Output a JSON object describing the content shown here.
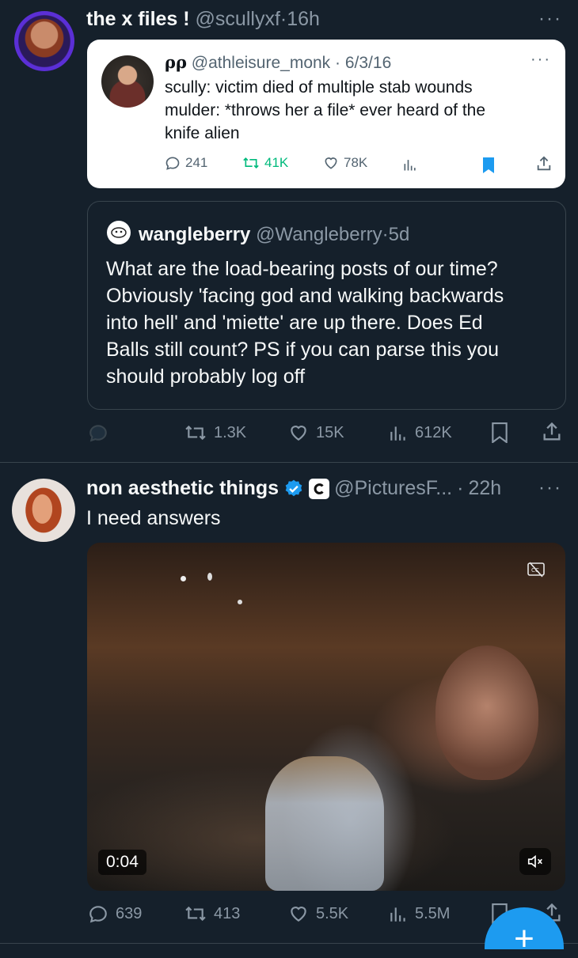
{
  "tweet1": {
    "display_name": "the x files !",
    "handle": "@scullyxf",
    "time": "16h",
    "more": "···",
    "embedded": {
      "display_name": "ρρ",
      "handle": "@athleisure_monk",
      "date": "6/3/16",
      "text_lines": [
        "scully: victim died of multiple stab wounds",
        "mulder: *throws her a file* ever heard of the",
        "knife alien"
      ],
      "replies": "241",
      "reposts": "41K",
      "likes": "78K",
      "more": "···"
    },
    "quote": {
      "display_name": "wangleberry",
      "handle": "@Wangleberry",
      "time": "5d",
      "text_lines": [
        "What are the load-bearing posts of our time?",
        "Obviously 'facing god and walking backwards",
        "into hell' and 'miette' are up there. Does Ed",
        "Balls still count? PS if you can parse this you",
        "should probably log off"
      ]
    },
    "reposts": "1.3K",
    "likes": "15K",
    "views": "612K"
  },
  "tweet2": {
    "display_name": "non aesthetic things",
    "handle": "@PicturesF...",
    "time": "22h",
    "more": "···",
    "text": "I need answers",
    "video_time": "0:04",
    "replies": "639",
    "reposts": "413",
    "likes": "5.5K",
    "views": "5.5M"
  },
  "colors": {
    "background": "#15202b",
    "accent": "#1d9bf0",
    "repost_green": "#00ba7c",
    "muted": "#8b98a5"
  },
  "compose_button": "+"
}
